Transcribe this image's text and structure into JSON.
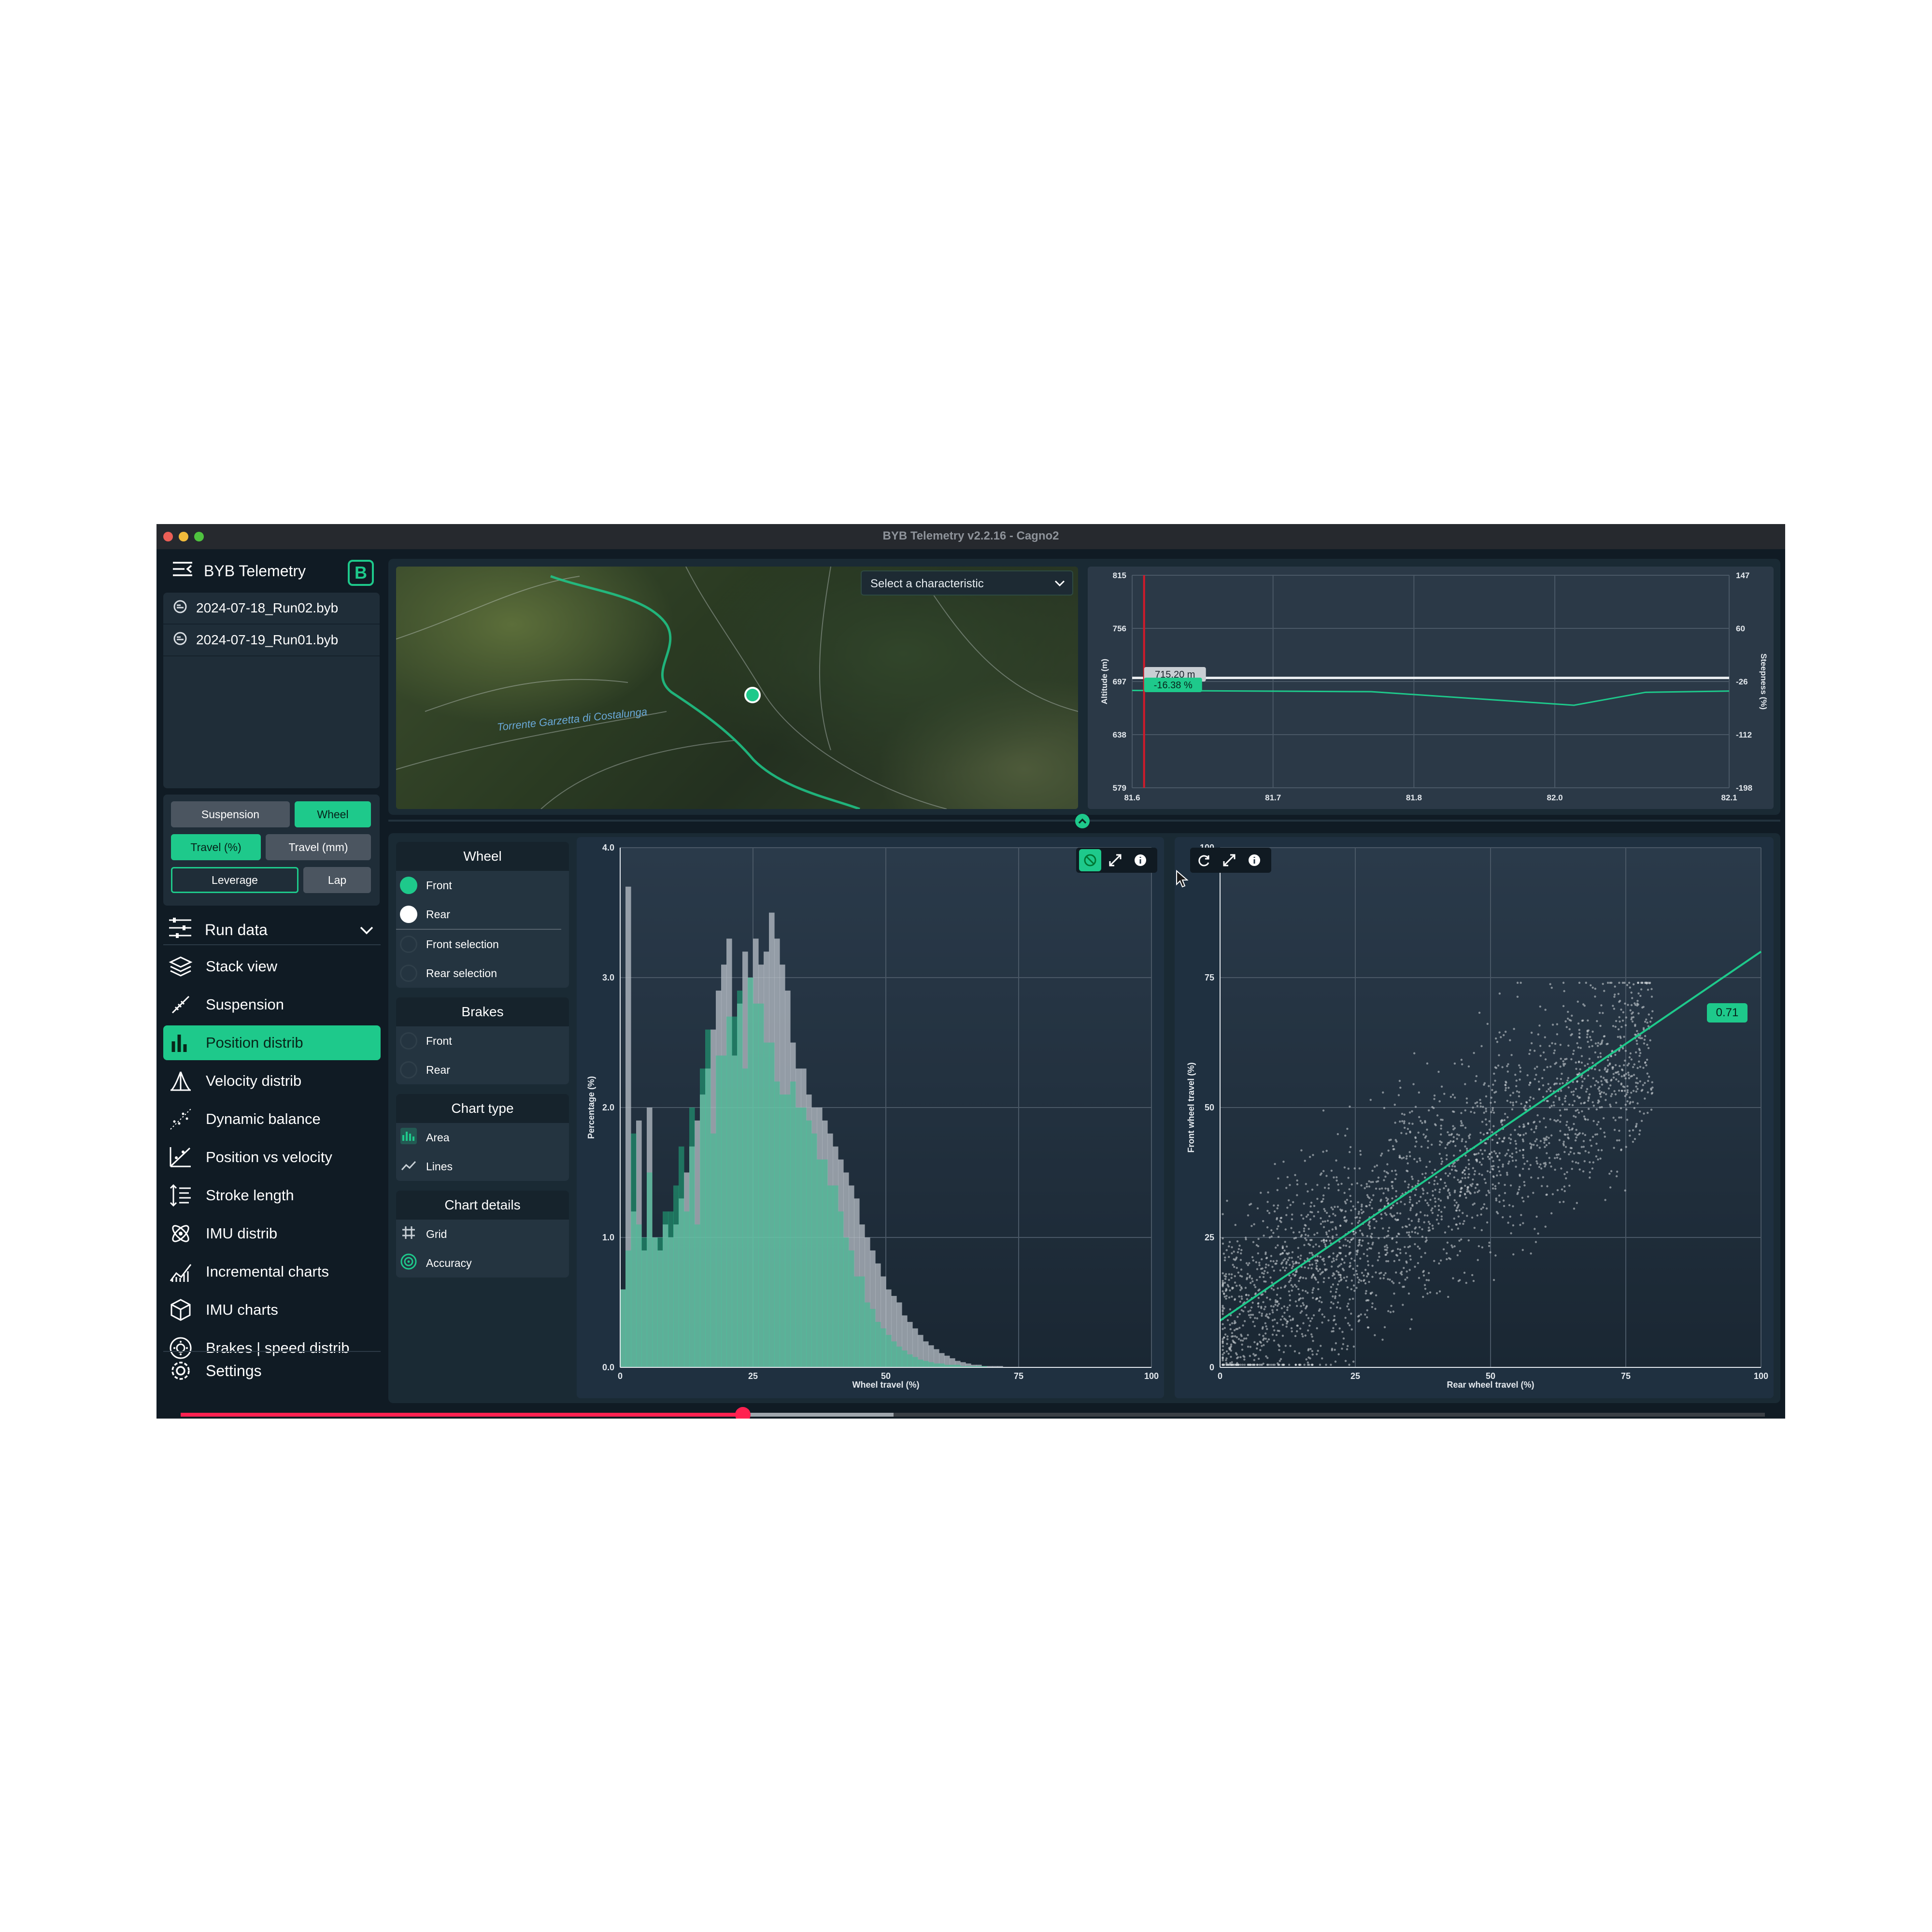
{
  "window": {
    "title": "BYB Telemetry v2.2.16 - Cagno2"
  },
  "sidebar": {
    "app_name": "BYB Telemetry",
    "logo_letter": "B",
    "files": [
      "2024-07-18_Run02.byb",
      "2024-07-19_Run01.byb"
    ],
    "filters": {
      "suspension": "Suspension",
      "wheel": "Wheel",
      "travel_pct": "Travel (%)",
      "travel_mm": "Travel (mm)",
      "leverage": "Leverage",
      "lap": "Lap"
    },
    "run_data": "Run data",
    "nav": [
      {
        "label": "Stack view",
        "icon": "layers-icon"
      },
      {
        "label": "Suspension",
        "icon": "shock-icon"
      },
      {
        "label": "Position distrib",
        "icon": "bar-chart-icon",
        "active": true
      },
      {
        "label": "Velocity distrib",
        "icon": "velocity-distrib-icon"
      },
      {
        "label": "Dynamic balance",
        "icon": "scatter-icon"
      },
      {
        "label": "Position vs velocity",
        "icon": "position-velocity-icon"
      },
      {
        "label": "Stroke length",
        "icon": "stroke-length-icon"
      },
      {
        "label": "IMU distrib",
        "icon": "imu-distrib-icon"
      },
      {
        "label": "Incremental charts",
        "icon": "incremental-chart-icon"
      },
      {
        "label": "IMU charts",
        "icon": "cube-icon"
      },
      {
        "label": "Brakes | speed distrib",
        "icon": "brake-disc-icon"
      }
    ],
    "settings": "Settings"
  },
  "map": {
    "select_placeholder": "Select a characteristic",
    "place_label": "Torrente Garzetta di Costalunga"
  },
  "playback": {
    "progress": 0.355,
    "buffered": 0.45
  },
  "options": {
    "wheel": {
      "title": "Wheel",
      "items": [
        "Front",
        "Rear",
        "Front selection",
        "Rear selection"
      ]
    },
    "brakes": {
      "title": "Brakes",
      "items": [
        "Front",
        "Rear"
      ]
    },
    "chart_type": {
      "title": "Chart type",
      "items": [
        "Area",
        "Lines"
      ]
    },
    "chart_details": {
      "title": "Chart details",
      "items": [
        "Grid",
        "Accuracy"
      ]
    }
  },
  "colors": {
    "accent": "#1ec98b",
    "background": "#101b24",
    "panel": "#1f3040",
    "front": "#1ec98b",
    "rear": "#b9c0c8",
    "cursor": "#d11a2a"
  },
  "chart_data": [
    {
      "type": "line",
      "xlabel": "",
      "ylabel": "Altitude (m)",
      "y2label": "Steepness (%)",
      "xlim": [
        81.6,
        82.1
      ],
      "ylim": [
        579,
        815
      ],
      "y2lim": [
        -198,
        147
      ],
      "x_ticks": [
        "81.6",
        "81.7",
        "81.8",
        "82.0",
        "82.1"
      ],
      "y_ticks": [
        "579",
        "638",
        "697",
        "756",
        "815"
      ],
      "y2_ticks": [
        "-198",
        "-112",
        "-26",
        "60",
        "147"
      ],
      "cursor_x": 81.61,
      "cursor_altitude_label": "715.20 m",
      "cursor_steepness_label": "-16.38 %",
      "series": [
        {
          "name": "",
          "x": [
            81.6,
            82.1
          ],
          "values": [
            701,
            701
          ]
        },
        {
          "name": "",
          "x": [
            81.6,
            81.8,
            81.97,
            82.03,
            82.1
          ],
          "values": [
            -40,
            -42,
            -64,
            -43,
            -41
          ],
          "axis": "y2"
        }
      ]
    },
    {
      "type": "bar",
      "xlabel": "Wheel travel (%)",
      "ylabel": "Percentage (%)",
      "xlim": [
        0,
        100
      ],
      "ylim": [
        0,
        4.0
      ],
      "x_ticks": [
        "0",
        "25",
        "50",
        "75",
        "100"
      ],
      "y_ticks": [
        "0.0",
        "1.0",
        "2.0",
        "3.0",
        "4.0"
      ],
      "bin_width": 1,
      "series": [
        {
          "name": "Rear",
          "values": [
            0.6,
            3.7,
            1.2,
            1.9,
            0.9,
            2.0,
            1.0,
            0.9,
            1.1,
            1.0,
            1.1,
            1.3,
            1.5,
            1.7,
            1.9,
            2.1,
            2.3,
            2.6,
            2.9,
            3.1,
            3.3,
            2.4,
            2.8,
            3.2,
            3.0,
            3.3,
            3.1,
            3.2,
            3.5,
            3.3,
            3.1,
            2.9,
            2.5,
            2.3,
            2.3,
            2.1,
            2.0,
            2.0,
            1.9,
            1.8,
            1.7,
            1.6,
            1.5,
            1.4,
            1.3,
            1.1,
            1.0,
            0.9,
            0.8,
            0.7,
            0.6,
            0.55,
            0.5,
            0.4,
            0.35,
            0.3,
            0.25,
            0.2,
            0.17,
            0.14,
            0.11,
            0.09,
            0.07,
            0.05,
            0.04,
            0.03,
            0.02,
            0.02,
            0.01,
            0.01,
            0.01,
            0.01,
            0.0,
            0.0,
            0.0,
            0.0,
            0.0,
            0.0,
            0.0,
            0.0,
            0.0,
            0.0,
            0.0,
            0.0,
            0.0,
            0.0,
            0.0,
            0.0,
            0.0,
            0.0,
            0.0,
            0.0,
            0.0,
            0.0,
            0.0,
            0.0,
            0.0,
            0.0,
            0.0,
            0.0
          ]
        },
        {
          "name": "Front",
          "values": [
            0.6,
            0.9,
            1.8,
            1.1,
            1.0,
            1.5,
            1.0,
            1.0,
            1.2,
            1.2,
            1.4,
            1.7,
            1.2,
            2.0,
            1.1,
            2.3,
            2.6,
            1.8,
            2.4,
            2.4,
            2.7,
            2.7,
            2.9,
            2.3,
            3.0,
            2.8,
            2.8,
            2.5,
            2.5,
            2.2,
            2.1,
            2.1,
            2.2,
            2.0,
            2.0,
            1.9,
            1.8,
            1.6,
            1.6,
            1.4,
            1.4,
            1.2,
            1.0,
            0.9,
            0.7,
            0.7,
            0.5,
            0.45,
            0.35,
            0.3,
            0.25,
            0.2,
            0.16,
            0.13,
            0.1,
            0.08,
            0.06,
            0.05,
            0.04,
            0.03,
            0.03,
            0.02,
            0.02,
            0.02,
            0.01,
            0.01,
            0.01,
            0.01,
            0.01,
            0.0,
            0.0,
            0.0,
            0.0,
            0.0,
            0.0,
            0.0,
            0.0,
            0.0,
            0.0,
            0.0,
            0.0,
            0.0,
            0.0,
            0.0,
            0.0,
            0.0,
            0.0,
            0.0,
            0.0,
            0.0,
            0.0,
            0.0,
            0.0,
            0.0,
            0.0,
            0.0,
            0.0,
            0.0,
            0.0,
            0.0
          ]
        }
      ]
    },
    {
      "type": "scatter",
      "xlabel": "Rear wheel travel (%)",
      "ylabel": "Front wheel travel (%)",
      "xlim": [
        0,
        100
      ],
      "ylim": [
        0,
        100
      ],
      "x_ticks": [
        "0",
        "25",
        "50",
        "75",
        "100"
      ],
      "y_ticks": [
        "0",
        "25",
        "50",
        "75",
        "100"
      ],
      "point_count": 2600,
      "trend_line": {
        "x": [
          0,
          100
        ],
        "y": [
          9,
          80
        ],
        "label": "0.71"
      }
    }
  ]
}
